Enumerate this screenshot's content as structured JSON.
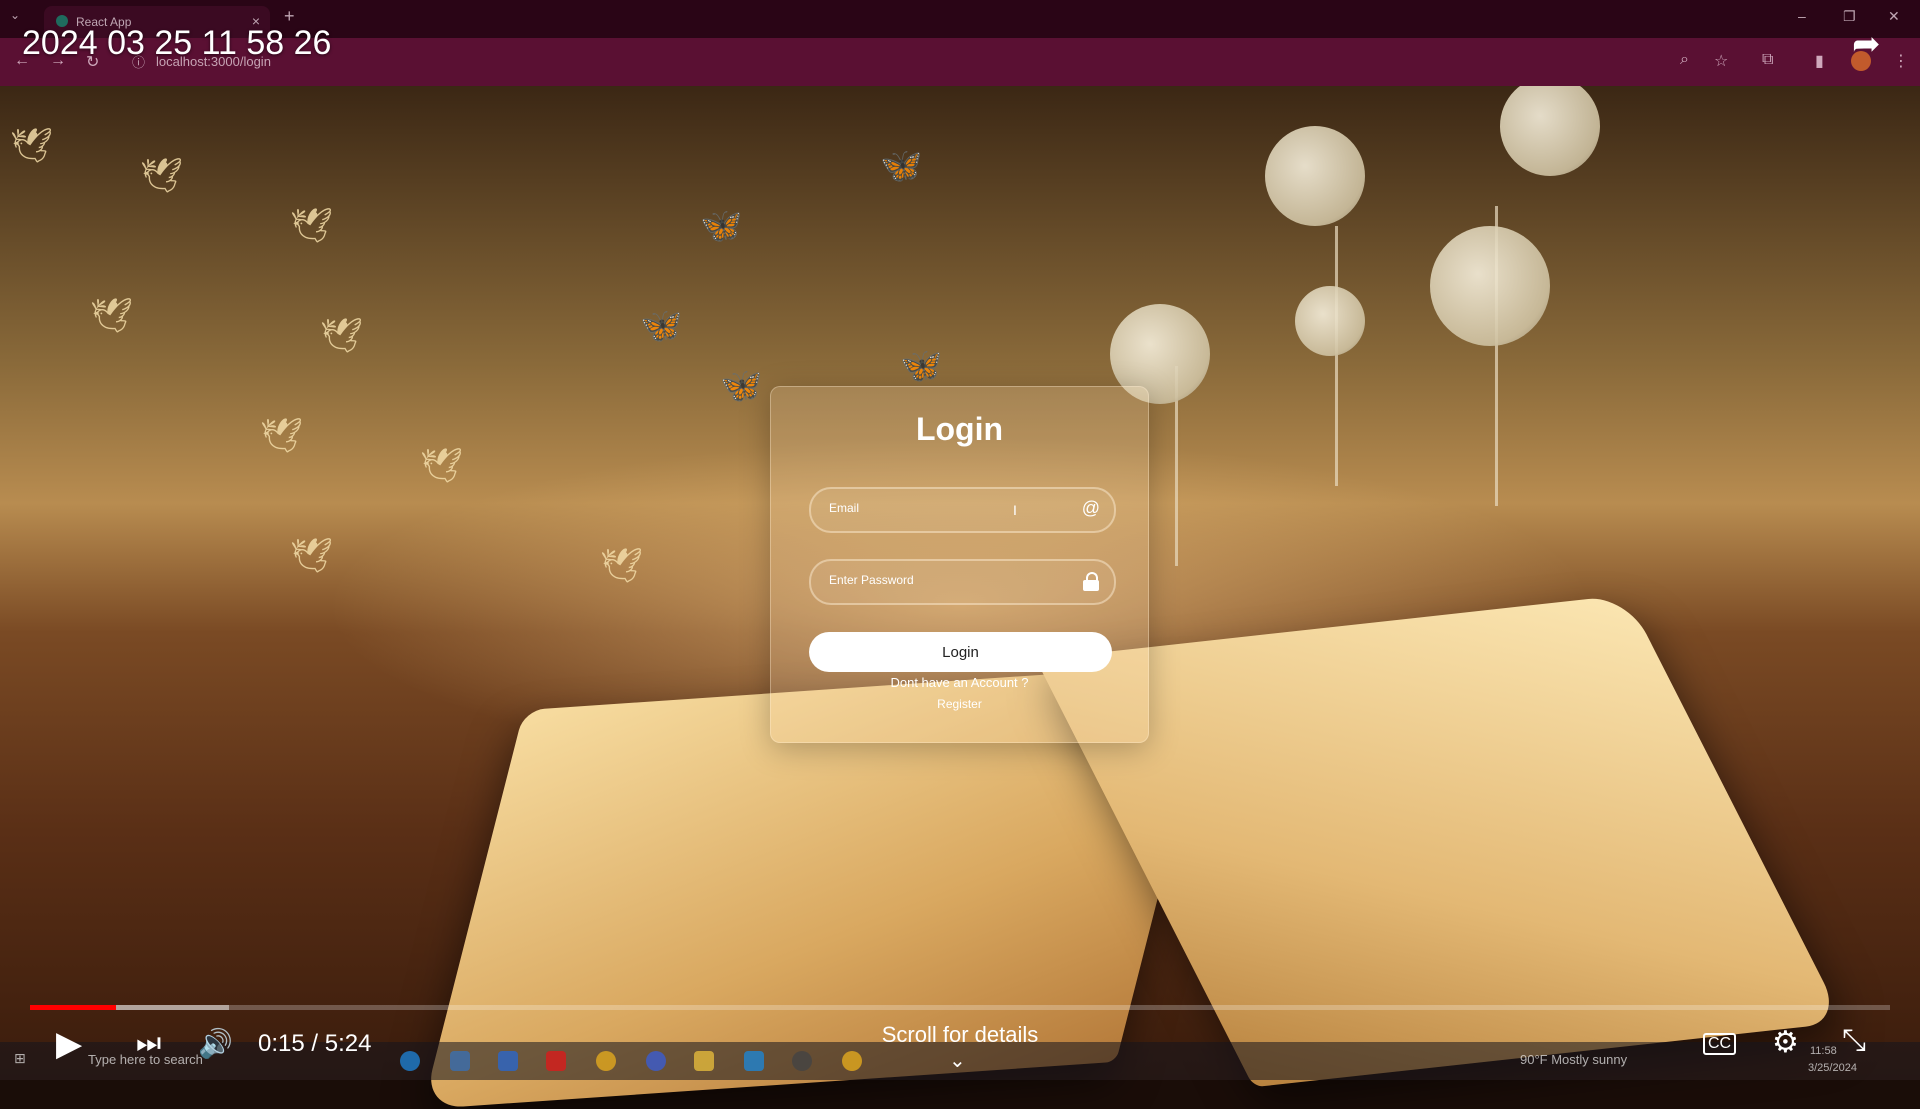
{
  "browser": {
    "tab_title": "React App",
    "url": "localhost:3000/login"
  },
  "login": {
    "title": "Login",
    "email_placeholder": "Email",
    "password_placeholder": "Enter Password",
    "button_label": "Login",
    "no_account_text": "Dont have an Account ?",
    "register_label": "Register"
  },
  "video": {
    "overlay_timestamp": "2024 03 25 11 58 26",
    "current_time": "0:15",
    "duration": "5:24",
    "time_display": "0:15 / 5:24",
    "played_fraction": 0.046,
    "buffered_fraction": 0.107,
    "scroll_hint": "Scroll for details"
  },
  "taskbar": {
    "search_placeholder": "Type here to search",
    "weather": "90°F  Mostly sunny",
    "clock_time": "11:58",
    "clock_date": "3/25/2024"
  },
  "icons": [
    "tab-list-icon",
    "close-tab-icon",
    "new-tab-icon",
    "back-icon",
    "forward-icon",
    "reload-icon",
    "zoom-icon",
    "star-icon",
    "extension-icon",
    "sidebar-icon",
    "menu-icon",
    "at-icon",
    "lock-icon",
    "share-icon",
    "play-icon",
    "next-icon",
    "volume-icon",
    "captions-icon",
    "settings-icon",
    "exit-fullscreen-icon",
    "chevron-down-icon",
    "windows-icon"
  ]
}
